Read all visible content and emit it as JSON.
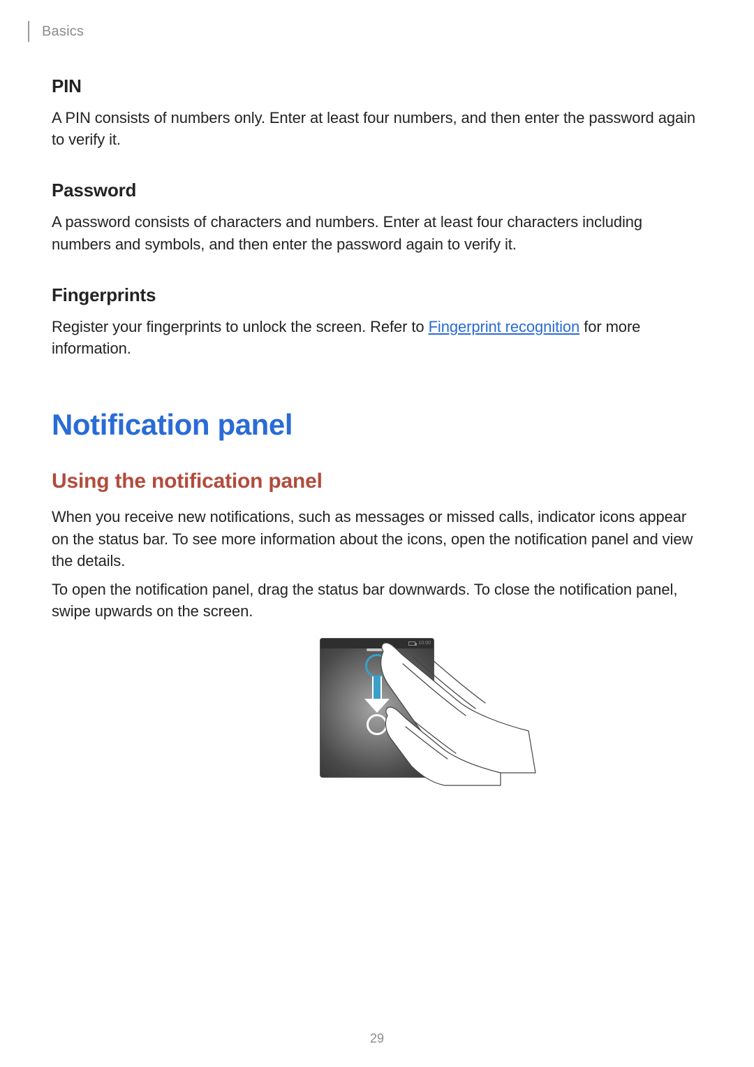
{
  "breadcrumb": "Basics",
  "sections": {
    "pin": {
      "title": "PIN",
      "body": "A PIN consists of numbers only. Enter at least four numbers, and then enter the password again to verify it."
    },
    "password": {
      "title": "Password",
      "body": "A password consists of characters and numbers. Enter at least four characters including numbers and symbols, and then enter the password again to verify it."
    },
    "fingerprints": {
      "title": "Fingerprints",
      "body_prefix": "Register your fingerprints to unlock the screen. Refer to ",
      "link_text": "Fingerprint recognition",
      "body_suffix": " for more information."
    }
  },
  "h1": "Notification panel",
  "h2": "Using the notification panel",
  "notif_p1": "When you receive new notifications, such as messages or missed calls, indicator icons appear on the status bar. To see more information about the icons, open the notification panel and view the details.",
  "notif_p2": "To open the notification panel, drag the status bar downwards. To close the notification panel, swipe upwards on the screen.",
  "statusbar_time": "10:00",
  "page_number": "29"
}
